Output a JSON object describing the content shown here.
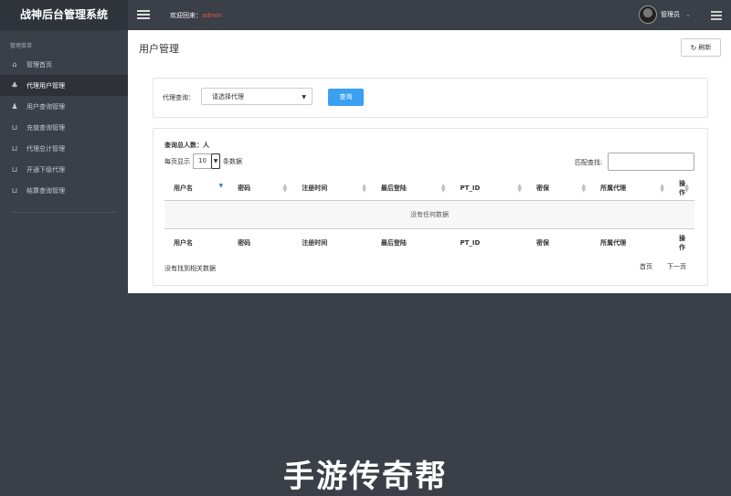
{
  "app_title": "战神后台管理系统",
  "header": {
    "welcome_prefix": "欢迎回来：",
    "welcome_user": "admin",
    "account_label": "管理员"
  },
  "sidebar": {
    "section_title": "管理菜单",
    "items": [
      {
        "label": "管理首页",
        "icon": "home-icon"
      },
      {
        "label": "代理用户管理",
        "icon": "sitemap-icon"
      },
      {
        "label": "用户查询管理",
        "icon": "person-icon"
      },
      {
        "label": "充值查询管理",
        "icon": "cart-icon"
      },
      {
        "label": "代理总计管理",
        "icon": "cart-icon"
      },
      {
        "label": "开通下级代理",
        "icon": "cart-icon"
      },
      {
        "label": "结算查询管理",
        "icon": "cart-icon"
      }
    ],
    "active_index": 1
  },
  "page": {
    "title": "用户管理",
    "refresh_label": "刷新"
  },
  "filter": {
    "label": "代理查询：",
    "select_value": "请选择代理",
    "query_button": "查询"
  },
  "table_panel": {
    "total_label": "查询总人数：人",
    "per_page_prefix": "每页显示",
    "per_page_value": "10",
    "per_page_suffix": "条数据",
    "search_label": "匹配查找:",
    "columns": [
      "用户名",
      "密码",
      "注册时间",
      "最后登陆",
      "PT_ID",
      "密保",
      "所属代理",
      "操作"
    ],
    "empty_message": "没有任何数据",
    "info_text": "没有找到相关数据",
    "first_page": "首页",
    "next_page": "下一页"
  },
  "watermark": "手游传奇帮",
  "colors": {
    "sidebar_bg": "#3a3f48",
    "brand_bg": "#2f343b",
    "primary_button": "#3ca0f0",
    "welcome_user": "#e05a4e"
  }
}
